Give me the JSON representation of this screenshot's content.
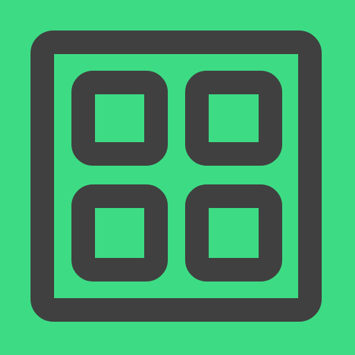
{
  "icon": {
    "name": "grid-layout-icon",
    "background_color": "#3ddc84",
    "stroke_color": "#404040",
    "tiles": [
      {
        "name": "top-left-tile"
      },
      {
        "name": "top-right-tile"
      },
      {
        "name": "bottom-left-tile"
      },
      {
        "name": "bottom-right-tile"
      }
    ]
  }
}
